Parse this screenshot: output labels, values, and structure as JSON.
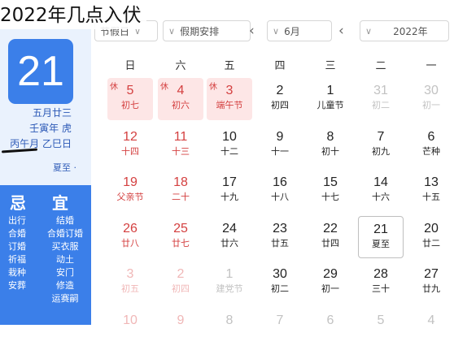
{
  "overlay_title": "2022年几点入伏",
  "toolbar": {
    "holiday_placeholder": "节假日",
    "holiday_schedule": "假期安排",
    "month": "6月",
    "year": "2022年"
  },
  "sidebar": {
    "day": "21",
    "lunar_date": "五月廿三",
    "ganzhi_year": "壬寅年 虎",
    "ganzhi_detail": "丙午月 乙巳日",
    "solar_term": "夏至",
    "yi_label": "宜",
    "ji_label": "忌",
    "ji_items": [
      "出行",
      "合婚订婚",
      "祈福",
      "栽种",
      "安葬"
    ],
    "yi_items_col1": [
      "结婚",
      "合婚订婚",
      "买衣服",
      "动土",
      "安门",
      "修造",
      "运赛嗣"
    ],
    "yi_items_col2": [
      "出行",
      "祈福",
      "栽种"
    ]
  },
  "weekdays": [
    "一",
    "二",
    "三",
    "四",
    "五",
    "六",
    "日"
  ],
  "calendar": {
    "rows": [
      [
        {
          "num": "30",
          "lunar": "初一",
          "state": "faded"
        },
        {
          "num": "31",
          "lunar": "初二",
          "state": "faded"
        },
        {
          "num": "1",
          "lunar": "儿童节",
          "state": ""
        },
        {
          "num": "2",
          "lunar": "初四",
          "state": ""
        },
        {
          "num": "3",
          "lunar": "端午节",
          "state": "holiday",
          "tag": "休"
        },
        {
          "num": "4",
          "lunar": "初六",
          "state": "holiday",
          "tag": "休"
        },
        {
          "num": "5",
          "lunar": "初七",
          "state": "holiday",
          "tag": "休"
        }
      ],
      [
        {
          "num": "6",
          "lunar": "芒种",
          "state": ""
        },
        {
          "num": "7",
          "lunar": "初九",
          "state": ""
        },
        {
          "num": "8",
          "lunar": "初十",
          "state": ""
        },
        {
          "num": "9",
          "lunar": "十一",
          "state": ""
        },
        {
          "num": "10",
          "lunar": "十二",
          "state": ""
        },
        {
          "num": "11",
          "lunar": "十三",
          "state": "weekend"
        },
        {
          "num": "12",
          "lunar": "十四",
          "state": "weekend"
        }
      ],
      [
        {
          "num": "13",
          "lunar": "十五",
          "state": ""
        },
        {
          "num": "14",
          "lunar": "十六",
          "state": ""
        },
        {
          "num": "15",
          "lunar": "十七",
          "state": ""
        },
        {
          "num": "16",
          "lunar": "十八",
          "state": ""
        },
        {
          "num": "17",
          "lunar": "十九",
          "state": ""
        },
        {
          "num": "18",
          "lunar": "二十",
          "state": "weekend"
        },
        {
          "num": "19",
          "lunar": "父亲节",
          "state": "weekend"
        }
      ],
      [
        {
          "num": "20",
          "lunar": "廿二",
          "state": ""
        },
        {
          "num": "21",
          "lunar": "夏至",
          "state": "today"
        },
        {
          "num": "22",
          "lunar": "廿四",
          "state": ""
        },
        {
          "num": "23",
          "lunar": "廿五",
          "state": ""
        },
        {
          "num": "24",
          "lunar": "廿六",
          "state": ""
        },
        {
          "num": "25",
          "lunar": "廿七",
          "state": "weekend"
        },
        {
          "num": "26",
          "lunar": "廿八",
          "state": "weekend"
        }
      ],
      [
        {
          "num": "27",
          "lunar": "廿九",
          "state": ""
        },
        {
          "num": "28",
          "lunar": "三十",
          "state": ""
        },
        {
          "num": "29",
          "lunar": "初一",
          "state": ""
        },
        {
          "num": "30",
          "lunar": "初二",
          "state": ""
        },
        {
          "num": "1",
          "lunar": "建党节",
          "state": "faded"
        },
        {
          "num": "2",
          "lunar": "初四",
          "state": "faded weekend"
        },
        {
          "num": "3",
          "lunar": "初五",
          "state": "faded weekend"
        }
      ],
      [
        {
          "num": "4",
          "lunar": "",
          "state": "faded"
        },
        {
          "num": "5",
          "lunar": "",
          "state": "faded"
        },
        {
          "num": "6",
          "lunar": "",
          "state": "faded"
        },
        {
          "num": "7",
          "lunar": "",
          "state": "faded"
        },
        {
          "num": "8",
          "lunar": "",
          "state": "faded"
        },
        {
          "num": "9",
          "lunar": "",
          "state": "faded weekend"
        },
        {
          "num": "10",
          "lunar": "",
          "state": "faded weekend"
        }
      ]
    ]
  }
}
